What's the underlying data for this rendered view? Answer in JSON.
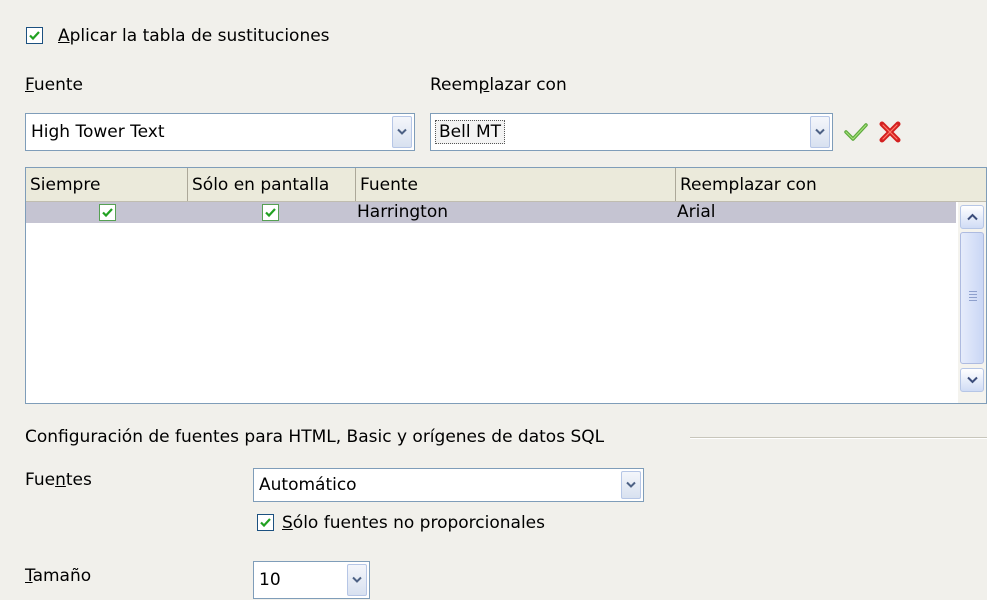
{
  "apply_table": {
    "checked": true,
    "label_accel": "A",
    "label_rest": "plicar la tabla de sustituciones"
  },
  "font_label": {
    "accel": "F",
    "rest": "uente"
  },
  "replace_label": {
    "before": "Reem",
    "accel": "p",
    "after": "lazar con"
  },
  "font_combo": {
    "value": "High Tower Text"
  },
  "replace_combo": {
    "value": "Bell MT"
  },
  "actions": {
    "apply_icon": "checkmark-icon",
    "delete_icon": "delete-x-icon",
    "apply_color": "#5ca93c",
    "delete_color": "#d32020"
  },
  "table": {
    "columns": [
      "Siempre",
      "Sólo en pantalla",
      "Fuente",
      "Reemplazar con"
    ],
    "rows": [
      {
        "always": true,
        "screen_only": true,
        "font": "Harrington",
        "replace": "Arial"
      }
    ]
  },
  "html_section": {
    "title": "Configuración de fuentes para HTML, Basic y orígenes de datos SQL"
  },
  "fonts_field": {
    "label_before": "Fue",
    "label_accel": "n",
    "label_after": "tes",
    "value": "Automático"
  },
  "monospace_only": {
    "checked": true,
    "label_accel": "S",
    "label_rest": "ólo fuentes no proporcionales"
  },
  "size_field": {
    "label_accel": "T",
    "label_rest": "amaño",
    "value": "10"
  }
}
